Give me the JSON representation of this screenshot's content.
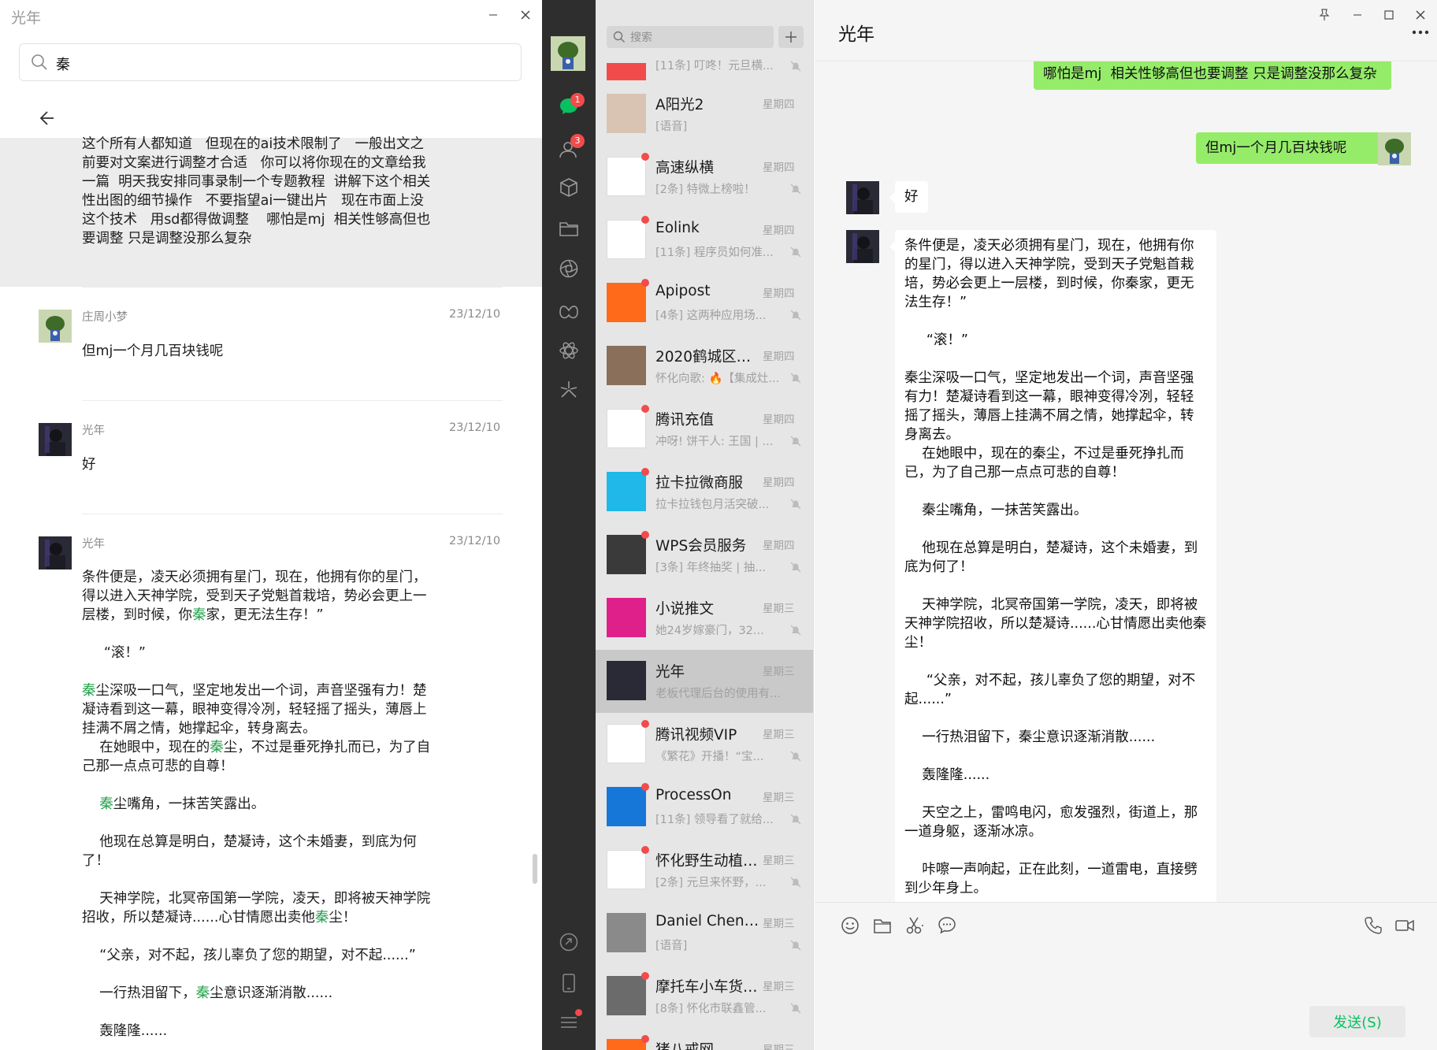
{
  "search_window": {
    "title": "光年",
    "search_value": "秦",
    "results": [
      {
        "body_parts": [
          {
            "t": "这个所有人都知道   但现在的ai技术限制了   一般出文之前要对文案进行调整才合适   你可以将你现在的文章给我一篇  明天我安排同事录制一个专题教程  讲解下这个相关性出图的细节操作   不要指望ai一键出片   现在市面上没这个技术   用sd都得做调整    哪怕是mj  相关性够高但也要调整 只是调整没那么复杂"
          }
        ]
      },
      {
        "name": "庄周小梦",
        "date": "23/12/10",
        "body_parts": [
          {
            "t": "但mj一个月几百块钱呢"
          }
        ]
      },
      {
        "name": "光年",
        "date": "23/12/10",
        "body_parts": [
          {
            "t": "好"
          }
        ]
      },
      {
        "name": "光年",
        "date": "23/12/10",
        "body_parts": [
          {
            "t": "条件便是，凌天必须拥有星门，现在，他拥有你的星门，得以进入天神学院，受到天子党魁首栽培，势必会更上一层楼，到时候，你"
          },
          {
            "t": "秦",
            "k": true
          },
          {
            "t": "家，更无法生存！”\n\n     “滚！”\n\n"
          },
          {
            "t": "秦",
            "k": true
          },
          {
            "t": "尘深吸一口气，坚定地发出一个词，声音坚强有力！楚凝诗看到这一幕，眼神变得冷冽，轻轻摇了摇头，薄唇上挂满不屑之情，她撑起伞，转身离去。\n    在她眼中，现在的"
          },
          {
            "t": "秦",
            "k": true
          },
          {
            "t": "尘，不过是垂死挣扎而已，为了自己那一点点可悲的自尊！\n\n    "
          },
          {
            "t": "秦",
            "k": true
          },
          {
            "t": "尘嘴角，一抹苦笑露出。\n\n    他现在总算是明白，楚凝诗，这个未婚妻，到底为何了！\n\n    天神学院，北冥帝国第一学院，凌天，即将被天神学院招收，所以楚凝诗......心甘情愿出卖他"
          },
          {
            "t": "秦",
            "k": true
          },
          {
            "t": "尘！\n\n    “父亲，对不起，孩儿辜负了您的期望，对不起......”\n\n    一行热泪留下，"
          },
          {
            "t": "秦",
            "k": true
          },
          {
            "t": "尘意识逐渐消散......\n\n    轰隆隆......"
          }
        ]
      }
    ]
  },
  "nav": {
    "chat_badge": "1",
    "contacts_badge": "3"
  },
  "chat_list": {
    "search_placeholder": "搜索",
    "partial_top": {
      "preview": "[11条] 叮咚！元旦横...",
      "time": ""
    },
    "items": [
      {
        "name": "A阳光2",
        "time": "星期四",
        "preview": "[语音]",
        "dot": false,
        "mute": false,
        "av": "#d9c4b4"
      },
      {
        "name": "高速纵横",
        "time": "星期四",
        "preview": "[2条] 特微上榜啦！",
        "dot": true,
        "mute": true,
        "av": "#ffffff"
      },
      {
        "name": "Eolink",
        "time": "星期四",
        "preview": "[11条] 程序员如何准...",
        "dot": true,
        "mute": true,
        "av": "#ffffff"
      },
      {
        "name": "Apipost",
        "time": "星期四",
        "preview": "[4条] 这两种应用场...",
        "dot": true,
        "mute": true,
        "av": "#ff6a1a"
      },
      {
        "name": "2020鹤城区创...",
        "time": "星期四",
        "preview": "怀化向歌: 🔥【集成灶...",
        "dot": false,
        "mute": true,
        "av": "#8a6f5a"
      },
      {
        "name": "腾讯充值",
        "time": "星期四",
        "preview": "冲呀! 饼干人: 王国 | ...",
        "dot": true,
        "mute": true,
        "av": "#ffffff"
      },
      {
        "name": "拉卡拉微商服",
        "time": "星期四",
        "preview": "拉卡拉钱包月活突破...",
        "dot": true,
        "mute": true,
        "av": "#1fb8e8"
      },
      {
        "name": "WPS会员服务",
        "time": "星期四",
        "preview": "[3条] 年终抽奖 | 抽...",
        "dot": true,
        "mute": true,
        "av": "#3a3a3a"
      },
      {
        "name": "小说推文",
        "time": "星期三",
        "preview": "她24岁嫁豪门，32...",
        "dot": false,
        "mute": true,
        "av": "#e0208a"
      },
      {
        "name": "光年",
        "time": "星期三",
        "preview": "老板代理后台的使用有...",
        "dot": false,
        "mute": false,
        "av": "#2a2a36",
        "selected": true
      },
      {
        "name": "腾讯视频VIP",
        "time": "星期三",
        "preview": "《繁花》开播！“宝...",
        "dot": true,
        "mute": true,
        "av": "#ffffff"
      },
      {
        "name": "ProcessOn",
        "time": "星期三",
        "preview": "[11条] 领导看了就给...",
        "dot": true,
        "mute": true,
        "av": "#1677d9"
      },
      {
        "name": "怀化野生动植物...",
        "time": "星期三",
        "preview": "[2条] 元旦来怀野，...",
        "dot": true,
        "mute": true,
        "av": "#ffffff"
      },
      {
        "name": "Daniel Chen-C...",
        "time": "星期三",
        "preview": "[语音]",
        "dot": false,
        "mute": true,
        "av": "#8a8a8a"
      },
      {
        "name": "摩托车小车货车...",
        "time": "星期三",
        "preview": "[8条] 怀化市联鑫管...",
        "dot": true,
        "mute": true,
        "av": "#6b6b6b"
      },
      {
        "name": "猪八戒网",
        "time": "星期三",
        "preview": "",
        "dot": true,
        "mute": true,
        "av": "#ff6a1a"
      }
    ]
  },
  "chat": {
    "title": "光年",
    "messages": {
      "me_top": "ai一键出片   现在市面上没这个技术   用sd都得做调整    哪怕是mj  相关性够高但也要调整 只是调整没那么复杂",
      "me_mj": "但mj一个月几百块钱呢",
      "other_ok": "好",
      "other_long": "条件便是，凌天必须拥有星门，现在，他拥有你的星门，得以进入天神学院，受到天子党魁首栽培，势必会更上一层楼，到时候，你秦家，更无法生存！”\n\n     “滚！”\n\n秦尘深吸一口气，坚定地发出一个词，声音坚强有力！楚凝诗看到这一幕，眼神变得冷冽，轻轻摇了摇头，薄唇上挂满不屑之情，她撑起伞，转身离去。\n    在她眼中，现在的秦尘，不过是垂死挣扎而已，为了自己那一点点可悲的自尊！\n\n    秦尘嘴角，一抹苦笑露出。\n\n    他现在总算是明白，楚凝诗，这个未婚妻，到底为何了！\n\n    天神学院，北冥帝国第一学院，凌天，即将被天神学院招收，所以楚凝诗......心甘情愿出卖他秦尘！\n\n     “父亲，对不起，孩儿辜负了您的期望，对不起......”\n\n    一行热泪留下，秦尘意识逐渐消散......\n\n    轰隆隆......\n\n    天空之上，雷鸣电闪，愈发强烈，街道上，那一道身躯，逐渐冰凉。\n\n    咔嚓一声响起，正在此刻，一道雷电，直接劈到少年身上。"
    },
    "send_label": "发送(S)"
  },
  "colors": {
    "accent_green": "#07c160",
    "bubble_green": "#95ec69",
    "badge_red": "#f24b4b",
    "nav_dark": "#2e2e2e"
  },
  "icons": {
    "search": "search-icon",
    "back": "back-arrow-icon",
    "minimize": "minimize-icon",
    "maximize": "maximize-icon",
    "close": "close-icon",
    "pin": "pin-icon",
    "emoji": "emoji-icon",
    "folder": "folder-icon",
    "scissors": "scissors-icon",
    "comment": "comment-icon",
    "phone": "phone-icon",
    "video": "video-icon"
  }
}
